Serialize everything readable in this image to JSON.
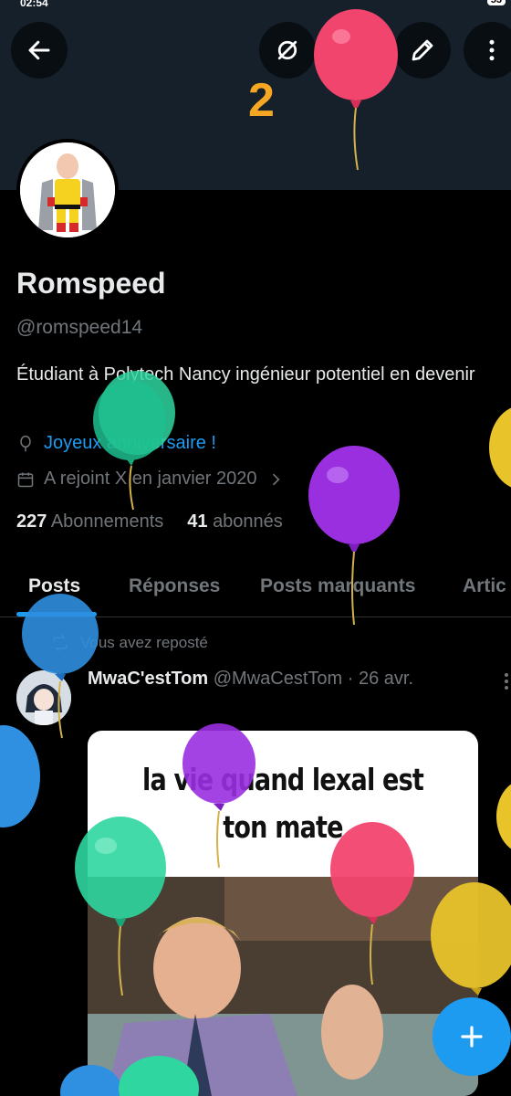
{
  "status_bar": {
    "time": "02:54",
    "battery": "53"
  },
  "header": {
    "back_icon": "arrow-left-icon",
    "grok_icon": "grok-slash-circle-icon",
    "search_icon": "search-icon",
    "edit_icon": "pen-icon",
    "more_icon": "vertical-dots-icon",
    "balloon_counter": "2"
  },
  "profile": {
    "display_name": "Romspeed",
    "handle": "@romspeed14",
    "bio": "Étudiant à Polytech Nancy ingénieur potentiel en devenir",
    "birthday_text": "Joyeux anniversaire !",
    "joined_text": "A rejoint X en janvier 2020",
    "following_count": "227",
    "following_label": "Abonnements",
    "followers_count": "41",
    "followers_label": "abonnés"
  },
  "tabs": [
    {
      "label": "Posts",
      "active": true
    },
    {
      "label": "Réponses",
      "active": false
    },
    {
      "label": "Posts marquants",
      "active": false
    },
    {
      "label": "Artic",
      "active": false
    }
  ],
  "post": {
    "repost_text": "Vous avez reposté",
    "author_name": "MwaC'estTom",
    "author_handle": "@MwaCestTom",
    "date": "· 26 avr.",
    "meme_caption_line1": "la vie quand lexal est",
    "meme_caption_line2": "ton mate"
  },
  "fab": {
    "icon": "plus-icon"
  },
  "colors": {
    "accent": "#1d9bf0",
    "background": "#000000",
    "banner": "#15202b",
    "muted_text": "#71767b",
    "counter": "#f5a623"
  }
}
